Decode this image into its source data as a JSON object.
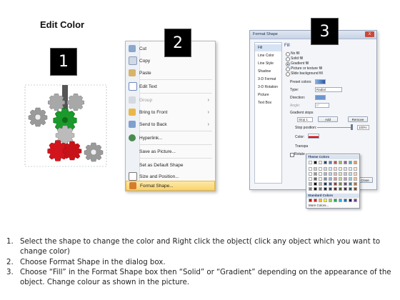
{
  "title": "Edit Color",
  "steps_markers": [
    "1",
    "2",
    "3"
  ],
  "context_menu": {
    "items": [
      {
        "label": "Cut",
        "icon": "scissors-icon",
        "enabled": true,
        "submenu": false
      },
      {
        "label": "Copy",
        "icon": "copy-icon",
        "enabled": true,
        "submenu": false
      },
      {
        "label": "Paste",
        "icon": "paste-icon",
        "enabled": true,
        "submenu": false
      },
      {
        "label": "Edit Text",
        "icon": "edit-text-icon",
        "enabled": true,
        "submenu": false
      },
      {
        "label": "Group",
        "icon": "group-icon",
        "enabled": false,
        "submenu": true
      },
      {
        "label": "Bring to Front",
        "icon": "bring-to-front-icon",
        "enabled": true,
        "submenu": true
      },
      {
        "label": "Send to Back",
        "icon": "send-to-back-icon",
        "enabled": true,
        "submenu": true
      },
      {
        "label": "Hyperlink...",
        "icon": "hyperlink-icon",
        "enabled": true,
        "submenu": false
      },
      {
        "label": "Save as Picture...",
        "icon": "",
        "enabled": true,
        "submenu": false
      },
      {
        "label": "Set as Default Shape",
        "icon": "",
        "enabled": true,
        "submenu": false
      },
      {
        "label": "Size and Position...",
        "icon": "size-position-icon",
        "enabled": true,
        "submenu": false
      },
      {
        "label": "Format Shape...",
        "icon": "format-shape-icon",
        "enabled": true,
        "submenu": false,
        "highlighted": true
      }
    ]
  },
  "dialog": {
    "title": "Format Shape",
    "close_label": "X",
    "nav": [
      "Fill",
      "Line Color",
      "Line Style",
      "Shadow",
      "3-D Format",
      "3-D Rotation",
      "Picture",
      "Text Box"
    ],
    "selected_nav": "Fill",
    "section_title": "Fill",
    "fill_options": [
      "No fill",
      "Solid fill",
      "Gradient fill",
      "Picture or texture fill",
      "Slide background fill"
    ],
    "selected_fill": "Gradient fill",
    "preset_colors_label": "Preset colors:",
    "type_label": "Type:",
    "type_value": "Radial",
    "direction_label": "Direction:",
    "angle_label": "Angle:",
    "angle_value": "0°",
    "gradient_stops_label": "Gradient stops",
    "stop_value": "Stop 1",
    "add_button": "Add",
    "remove_button": "Remove",
    "stop_position_label": "Stop position:",
    "stop_position_value": "100%",
    "color_label": "Color:",
    "transparency_label": "Transpa",
    "rotate_label": "Rotate",
    "close_button": "Close"
  },
  "palette": {
    "theme_header": "Theme Colors",
    "standard_header": "Standard Colors",
    "more_colors": "More Colors...",
    "theme_top_row": [
      "#ffffff",
      "#000000",
      "#eeece1",
      "#1f497d",
      "#4f81bd",
      "#c0504d",
      "#9bbb59",
      "#8064a2",
      "#4bacc6",
      "#f79646"
    ],
    "standard_colors": [
      "#c00000",
      "#ff0000",
      "#ffc000",
      "#ffff00",
      "#92d050",
      "#00b050",
      "#00b0f0",
      "#0070c0",
      "#002060",
      "#7030a0"
    ]
  },
  "instructions": [
    {
      "num": "1.",
      "text": "Select the shape to change the color and Right click the object( click any object which you want to change color)"
    },
    {
      "num": "2.",
      "text": "Choose Format Shape in the dialog box."
    },
    {
      "num": "3.",
      "text": "Choose “Fill” in the Format Shape box then “Solid” or “Gradient” depending on the appearance of the object. Change colour as shown in the picture."
    }
  ]
}
